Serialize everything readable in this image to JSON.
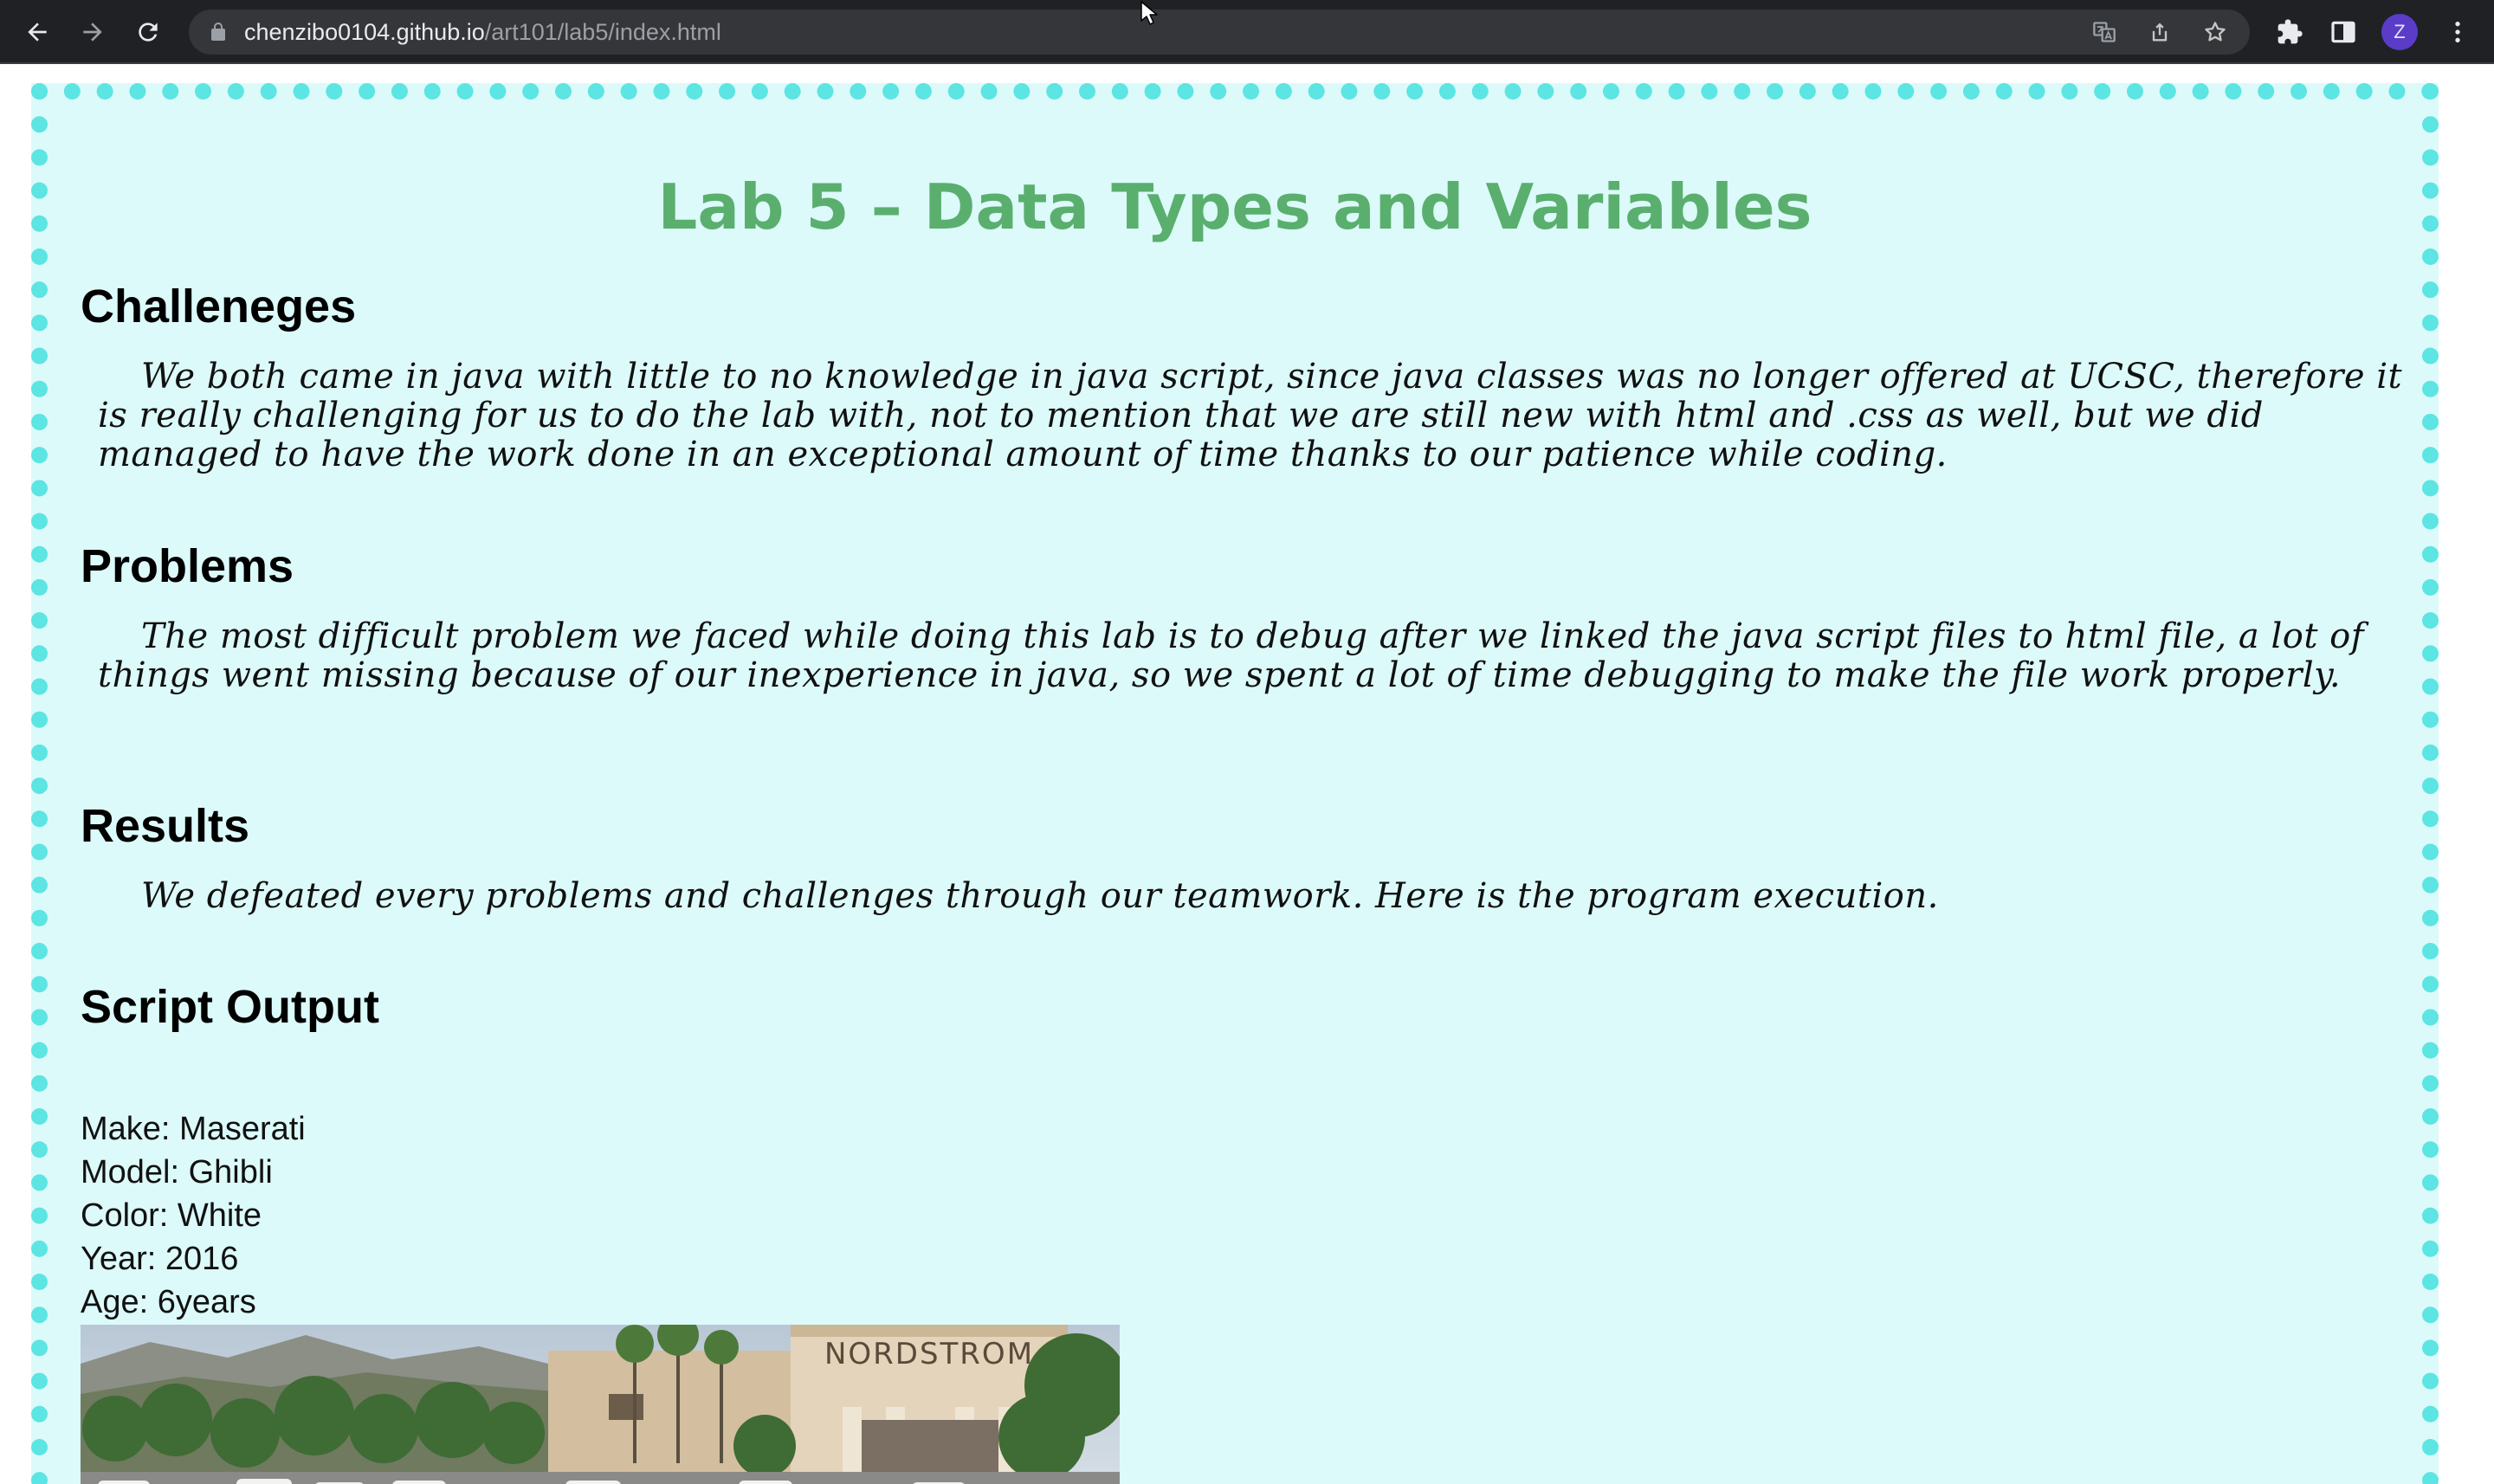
{
  "browser": {
    "url_host": "chenzibo0104.github.io",
    "url_path": "/art101/lab5/index.html",
    "profile_initial": "Z",
    "icons": {
      "back": "arrow-left-icon",
      "forward": "arrow-right-icon",
      "reload": "reload-icon",
      "lock": "lock-icon",
      "translate": "translate-icon",
      "share": "share-icon",
      "bookmark": "star-icon",
      "extensions": "puzzle-icon",
      "side_panel": "side-panel-icon",
      "menu": "kebab-menu-icon"
    }
  },
  "page": {
    "title": "Lab 5 – Data Types and Variables",
    "sections": [
      {
        "heading": "Challeneges",
        "body": "We both came in java with little to no knowledge in java script, since java classes was no longer offered at UCSC, therefore it is really challenging for us to do the lab with, not to mention that we are still new with html and .css as well, but we did managed to have the work done in an exceptional amount of time thanks to our patience while coding."
      },
      {
        "heading": "Problems",
        "body": "The most difficult problem we faced while doing this lab is to debug after we linked the java script files to html file, a lot of things went missing because of our inexperience in java, so we spent a lot of time debugging to make the file work properly."
      },
      {
        "heading": "Results",
        "body": "We defeated every problems and challenges through our teamwork. Here is the program execution."
      }
    ],
    "output": {
      "heading": "Script Output",
      "lines": [
        "Make: Maserati",
        "Model: Ghibli",
        "Color: White",
        "Year: 2016",
        "Age: 6years"
      ],
      "photo_sign": "NORDSTROM"
    }
  },
  "colors": {
    "chrome_bg": "#202124",
    "omnibox_bg": "#35363a",
    "page_bg": "#dcfafa",
    "dotted_border": "#5ce5e2",
    "title": "#5aaf6e"
  }
}
